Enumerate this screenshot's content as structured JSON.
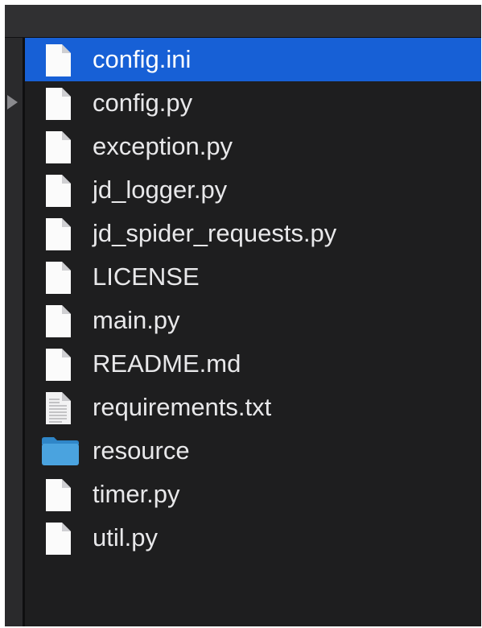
{
  "colors": {
    "window_bg": "#1e1e1f",
    "toolbar_bg": "#303032",
    "selection": "#1760d6",
    "text": "#e8e8ea",
    "folder": "#4aa3df"
  },
  "files": [
    {
      "name": "config.ini",
      "icon": "document-icon",
      "selected": true
    },
    {
      "name": "config.py",
      "icon": "document-icon",
      "selected": false
    },
    {
      "name": "exception.py",
      "icon": "document-icon",
      "selected": false
    },
    {
      "name": "jd_logger.py",
      "icon": "document-icon",
      "selected": false
    },
    {
      "name": "jd_spider_requests.py",
      "icon": "document-icon",
      "selected": false
    },
    {
      "name": "LICENSE",
      "icon": "document-icon",
      "selected": false
    },
    {
      "name": "main.py",
      "icon": "document-icon",
      "selected": false
    },
    {
      "name": "README.md",
      "icon": "document-icon",
      "selected": false
    },
    {
      "name": "requirements.txt",
      "icon": "text-document-icon",
      "selected": false
    },
    {
      "name": "resource",
      "icon": "folder-icon",
      "selected": false
    },
    {
      "name": "timer.py",
      "icon": "document-icon",
      "selected": false
    },
    {
      "name": "util.py",
      "icon": "document-icon",
      "selected": false
    }
  ]
}
